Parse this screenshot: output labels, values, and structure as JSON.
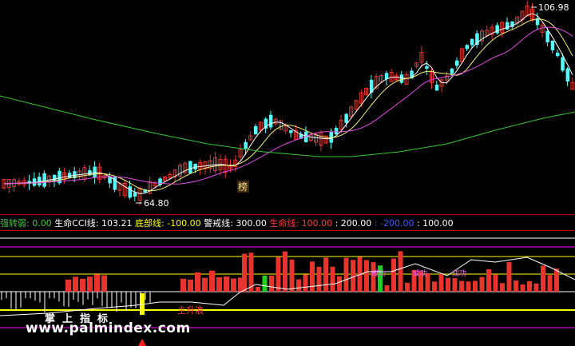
{
  "colors": {
    "background": "#000000",
    "up": "#e8342c",
    "down": "#54ffff",
    "ma_white": "#ffffff",
    "ma_yellow": "#f5f07a",
    "ma_magenta": "#e04be0",
    "ma_green": "#38c83a",
    "grid_red": "#c80000",
    "ref_yellow": "#ffff00",
    "ref_magenta": "#ff00ff"
  },
  "main_chart": {
    "high_label": "106.98",
    "low_label": "64.80",
    "marker_label": "榜"
  },
  "indicator_legend": {
    "items": [
      {
        "name": "强转弱",
        "sep": ": ",
        "value": "0.00",
        "color": "#38c83a"
      },
      {
        "name": "生命CCI线",
        "sep": ": ",
        "value": "103.21",
        "color": "#ffffff"
      },
      {
        "name": "底部线",
        "sep": ": ",
        "value": "-100.00",
        "color": "#ffff00"
      },
      {
        "name": "警戒线",
        "sep": ": ",
        "value": "300.00",
        "color": "#ffffff"
      },
      {
        "name": "生命线",
        "sep": ": ",
        "value": "100.00",
        "color": "#ff3b3b"
      },
      {
        "name": "",
        "sep": ": ",
        "value": "200.00",
        "color": "#ffffff"
      },
      {
        "name": "",
        "sep": ": ",
        "value": "-200.00",
        "color": "#3f5cff"
      },
      {
        "name": "",
        "sep": ": ",
        "value": "100.00",
        "color": "#ffffff"
      }
    ]
  },
  "indicator_chart": {
    "labels": {
      "rise": "主升浪",
      "tag": "成功"
    }
  },
  "brand": {
    "cn": "掌上指标",
    "url": "www.palmindex.com"
  }
}
